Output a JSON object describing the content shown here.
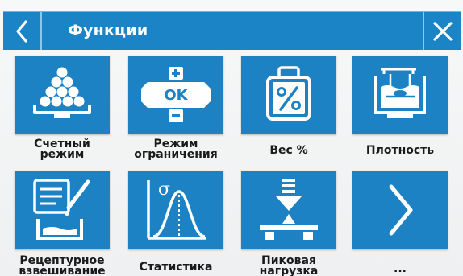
{
  "header": {
    "title": "Функции",
    "back_icon": "chevron-left-icon",
    "close_icon": "close-icon"
  },
  "colors": {
    "header_bg": "#1a84c6",
    "tile_bg": "#1c82c4",
    "icon_fg": "#ffffff",
    "label_fg": "#1a1a1a",
    "background": "#f2f3f4"
  },
  "tiles": [
    {
      "label": "Счетный\nрежим",
      "icon": "counting-balls-icon"
    },
    {
      "label": "Режим\nограничения",
      "icon": "checkweigh-ok-icon"
    },
    {
      "label": "Вес %",
      "icon": "percent-weight-icon"
    },
    {
      "label": "Плотность",
      "icon": "density-beaker-icon"
    },
    {
      "label": "Рецептурное\nвзвешивание",
      "icon": "recipe-dropper-icon"
    },
    {
      "label": "Статистика",
      "icon": "statistics-sigma-icon"
    },
    {
      "label": "Пиковая\nнагрузка",
      "icon": "peak-load-icon"
    },
    {
      "label": "...",
      "icon": "chevron-right-icon"
    }
  ]
}
